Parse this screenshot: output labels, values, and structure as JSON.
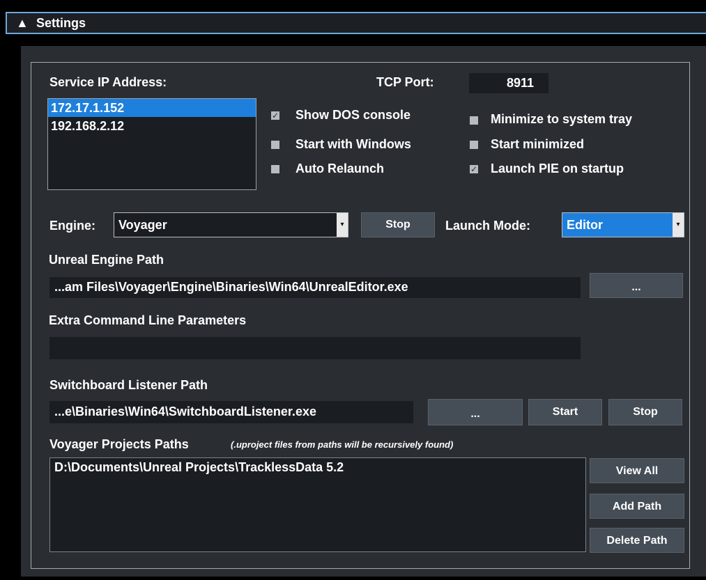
{
  "header": {
    "arrow": "▲",
    "title": "Settings"
  },
  "service_ip": {
    "label": "Service IP Address:",
    "items": [
      "172.17.1.152",
      "192.168.2.12"
    ],
    "selected_index": 0
  },
  "tcp_port": {
    "label": "TCP Port:",
    "value": "8911"
  },
  "checkboxes": [
    {
      "label": "Show DOS console",
      "checked": true
    },
    {
      "label": "Start with Windows",
      "checked": false
    },
    {
      "label": "Auto Relaunch",
      "checked": false
    },
    {
      "label": "Minimize to system tray",
      "checked": false
    },
    {
      "label": "Start minimized",
      "checked": false
    },
    {
      "label": "Launch PIE on startup",
      "checked": true
    }
  ],
  "engine": {
    "label": "Engine:",
    "selected": "Voyager",
    "stop_button": "Stop",
    "launch_mode_label": "Launch Mode:",
    "launch_mode_selected": "Editor"
  },
  "unreal_path": {
    "label": "Unreal Engine Path",
    "value": "...am Files\\Voyager\\Engine\\Binaries\\Win64\\UnrealEditor.exe",
    "browse_button": "..."
  },
  "extra_params": {
    "label": "Extra Command Line Parameters",
    "value": ""
  },
  "listener": {
    "label": "Switchboard Listener Path",
    "value": "...e\\Binaries\\Win64\\SwitchboardListener.exe",
    "browse_button": "...",
    "start_button": "Start",
    "stop_button": "Stop"
  },
  "projects": {
    "label": "Voyager Projects Paths",
    "note": "(.uproject files from paths will be recursively found)",
    "items": [
      "D:\\Documents\\Unreal Projects\\TracklessData 5.2"
    ],
    "view_all_button": "View All",
    "add_path_button": "Add Path",
    "delete_path_button": "Delete Path"
  },
  "icons": {
    "header_toggle": "collapse-triangle-icon",
    "combo_arrow": "dropdown-arrow-icon",
    "checkbox_check": "check-icon"
  },
  "colors": {
    "selection": "#1e80dc",
    "header_border": "#6ea8dc",
    "panel": "#2a2e33",
    "button": "#454d56"
  }
}
